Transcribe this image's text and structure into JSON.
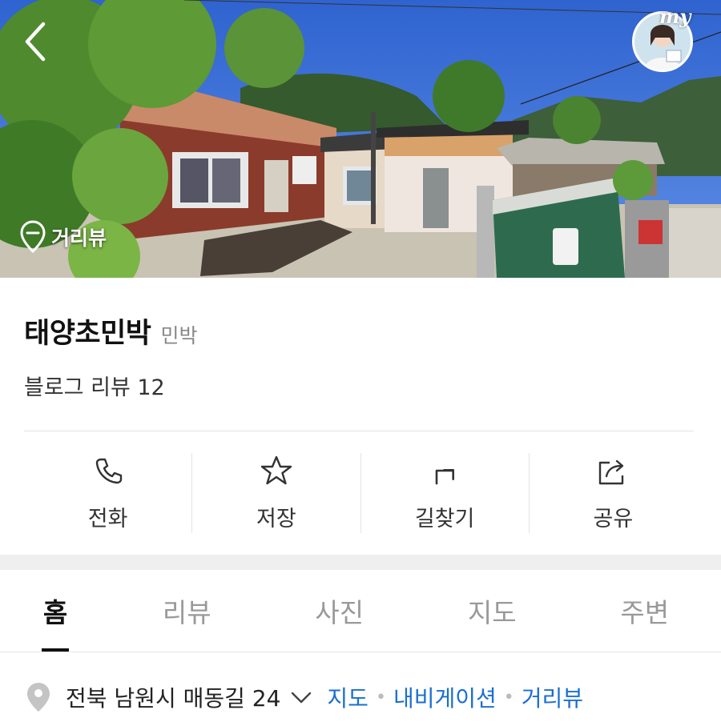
{
  "header": {
    "back_icon": "chevron-left-icon",
    "my_badge": "my",
    "streetview_label": "거리뷰"
  },
  "place": {
    "name": "태양초민박",
    "category": "민박",
    "review_summary": "블로그 리뷰 12"
  },
  "actions": [
    {
      "label": "전화",
      "icon": "phone-icon"
    },
    {
      "label": "저장",
      "icon": "star-icon"
    },
    {
      "label": "길찾기",
      "icon": "directions-arrow-icon"
    },
    {
      "label": "공유",
      "icon": "share-icon"
    }
  ],
  "tabs": [
    {
      "label": "홈",
      "active": true
    },
    {
      "label": "리뷰",
      "active": false
    },
    {
      "label": "사진",
      "active": false
    },
    {
      "label": "지도",
      "active": false
    },
    {
      "label": "주변",
      "active": false
    }
  ],
  "address": {
    "text": "전북 남원시 매동길 24",
    "links": [
      "지도",
      "내비게이션",
      "거리뷰"
    ]
  },
  "colors": {
    "link": "#1a6fd1",
    "sky": "#3a6fd8",
    "separator_band": "#efefef"
  }
}
